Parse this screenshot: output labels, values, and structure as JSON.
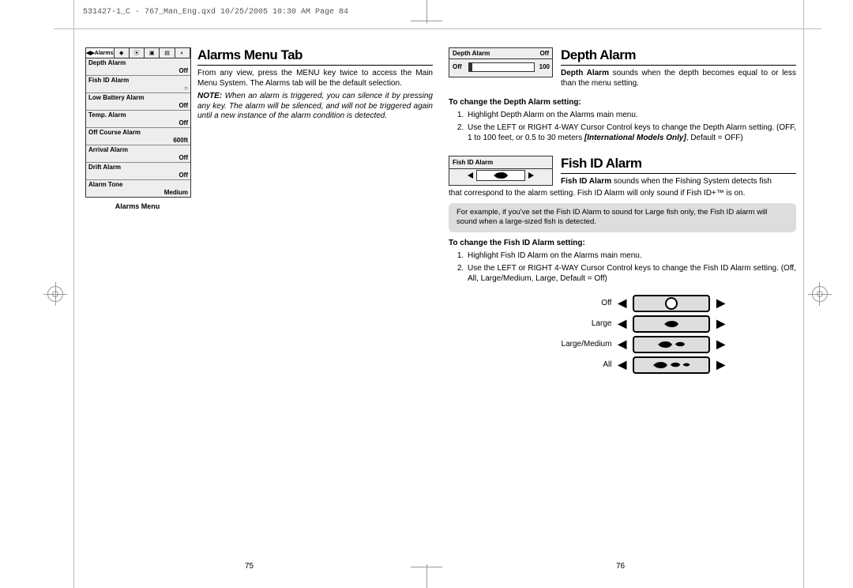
{
  "header": "531427-1_C - 767_Man_Eng.qxd  10/25/2005  10:30 AM  Page 84",
  "left_page": {
    "title": "Alarms Menu Tab",
    "caption": "Alarms Menu",
    "p1": "From any view, press the MENU key twice to access the Main Menu System. The Alarms tab will be the default selection.",
    "note": "NOTE: When an alarm is triggered, you can silence it by pressing any key.  The alarm will be silenced, and will not be triggered again until a new instance of the alarm condition is detected.",
    "menu": {
      "tab": "Alarms",
      "rows": [
        {
          "name": "Depth Alarm",
          "val": "Off"
        },
        {
          "name": "Fish ID Alarm",
          "val": "○"
        },
        {
          "name": "Low Battery Alarm",
          "val": "Off"
        },
        {
          "name": "Temp. Alarm",
          "val": "Off"
        },
        {
          "name": "Off Course Alarm",
          "val": "600ft"
        },
        {
          "name": "Arrival Alarm",
          "val": "Off"
        },
        {
          "name": "Drift Alarm",
          "val": "Off"
        },
        {
          "name": "Alarm Tone",
          "val": "Medium"
        }
      ]
    },
    "pagenum": "75"
  },
  "right_page": {
    "depth": {
      "title": "Depth Alarm",
      "shot": {
        "name": "Depth Alarm",
        "val": "Off",
        "min": "Off",
        "max": "100"
      },
      "p1a": "Depth Alarm",
      "p1b": " sounds when the depth becomes equal to or less than the menu setting.",
      "subhead": "To change the Depth Alarm setting:",
      "li1": "Highlight Depth Alarm on the Alarms main menu.",
      "li2a": "Use the LEFT or RIGHT 4-WAY Cursor Control keys to change the Depth Alarm setting. (OFF, 1 to 100 feet, or 0.5 to 30 meters ",
      "li2b": "[International Models Only]",
      "li2c": ", Default = OFF)"
    },
    "fish": {
      "title": "Fish ID Alarm",
      "shot": {
        "name": "Fish ID Alarm"
      },
      "p1a": "Fish ID Alarm",
      "p1b": " sounds when the Fishing System detects fish that correspond to the alarm setting. Fish ID Alarm will only sound if Fish ID+™ is on.",
      "note": "For example, if you've set the Fish ID Alarm to sound for Large fish only, the Fish ID alarm will sound when a large-sized fish is detected.",
      "subhead": "To change the Fish ID Alarm setting:",
      "li1": "Highlight Fish ID Alarm on the Alarms main menu.",
      "li2": "Use the LEFT or RIGHT 4-WAY Cursor Control keys to change the Fish ID Alarm setting. (Off, All, Large/Medium, Large, Default = Off)",
      "options": [
        "Off",
        "Large",
        "Large/Medium",
        "All"
      ]
    },
    "pagenum": "76"
  }
}
